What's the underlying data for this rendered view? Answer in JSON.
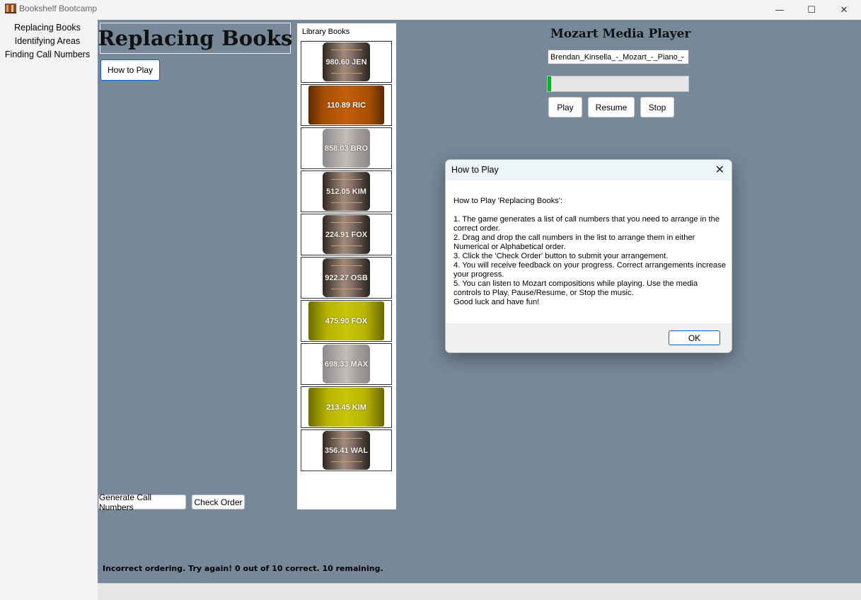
{
  "window": {
    "title": "Bookshelf Bootcamp",
    "controls": {
      "minimize": "—",
      "maximize": "☐",
      "close": "✕"
    }
  },
  "nav": {
    "items": [
      "Replacing Books",
      "Identifying Areas",
      "Finding Call Numbers"
    ]
  },
  "main": {
    "heading": "Replacing Books",
    "how_to_play_label": "How to Play",
    "generate_label": "Generate Call Numbers",
    "check_order_label": "Check Order",
    "feedback": "Incorrect ordering. Try again! 0 out of 10 correct. 10 remaining."
  },
  "library": {
    "label": "Library Books",
    "books": [
      {
        "call_number": "980.60 JEN",
        "style": "dark"
      },
      {
        "call_number": "110.89 RIC",
        "style": "orange"
      },
      {
        "call_number": "858.03 BRO",
        "style": "grey"
      },
      {
        "call_number": "512.05 KIM",
        "style": "dark"
      },
      {
        "call_number": "224.91 FOX",
        "style": "dark"
      },
      {
        "call_number": "922.27 OSB",
        "style": "dark"
      },
      {
        "call_number": "475.90 FOX",
        "style": "yellow"
      },
      {
        "call_number": "698.33 MAX",
        "style": "grey"
      },
      {
        "call_number": "213.45 KIM",
        "style": "yellow"
      },
      {
        "call_number": "356.41 WAL",
        "style": "dark"
      }
    ]
  },
  "media_player": {
    "title": "Mozart Media Player",
    "selected_track": "Brendan_Kinsella_-_Mozart_-_Piano_",
    "progress": 0.025,
    "progress_color": "#06b025",
    "play_label": "Play",
    "resume_label": "Resume",
    "stop_label": "Stop"
  },
  "dialog": {
    "title": "How to Play",
    "lines": [
      "How to Play 'Replacing Books':",
      "",
      "1. The game generates a list of call numbers that you need to arrange in the correct order.",
      "2. Drag and drop the call numbers in the list to arrange them in either Numerical or Alphabetical order.",
      "3. Click the 'Check Order' button to submit your arrangement.",
      "4. You will receive feedback on your progress. Correct arrangements increase your progress.",
      "5. You can listen to Mozart compositions while playing. Use the media controls to Play, Pause/Resume, or Stop the music.",
      "Good luck and have fun!"
    ],
    "ok_label": "OK"
  },
  "colors": {
    "client_bg": "#778899",
    "accent": "#0a66c2"
  }
}
